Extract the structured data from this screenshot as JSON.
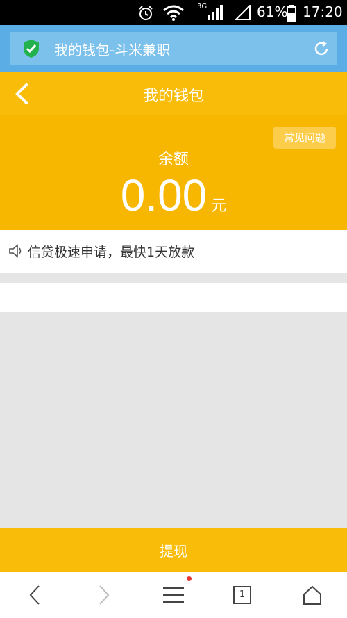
{
  "status_bar": {
    "network": "3G",
    "battery": "61%",
    "time": "17:20",
    "icons": [
      "alarm-icon",
      "wifi-icon",
      "signal-icon",
      "signal-outline-icon",
      "battery-icon"
    ]
  },
  "browser": {
    "url_title": "我的钱包-斗米兼职",
    "secure_icon": "shield-check-icon",
    "refresh_icon": "refresh-icon",
    "tab_count": "1"
  },
  "header": {
    "title": "我的钱包",
    "back_icon": "chevron-left-icon"
  },
  "balance": {
    "faq_label": "常见问题",
    "label": "余额",
    "value": "0.00",
    "unit": "元"
  },
  "notice": {
    "icon": "speaker-icon",
    "text": "信贷极速申请，最快1天放款"
  },
  "actions": {
    "withdraw_label": "提现"
  },
  "colors": {
    "accent": "#f9bd09",
    "browser_blue": "#5aaee5",
    "badge_red": "#e53935"
  }
}
